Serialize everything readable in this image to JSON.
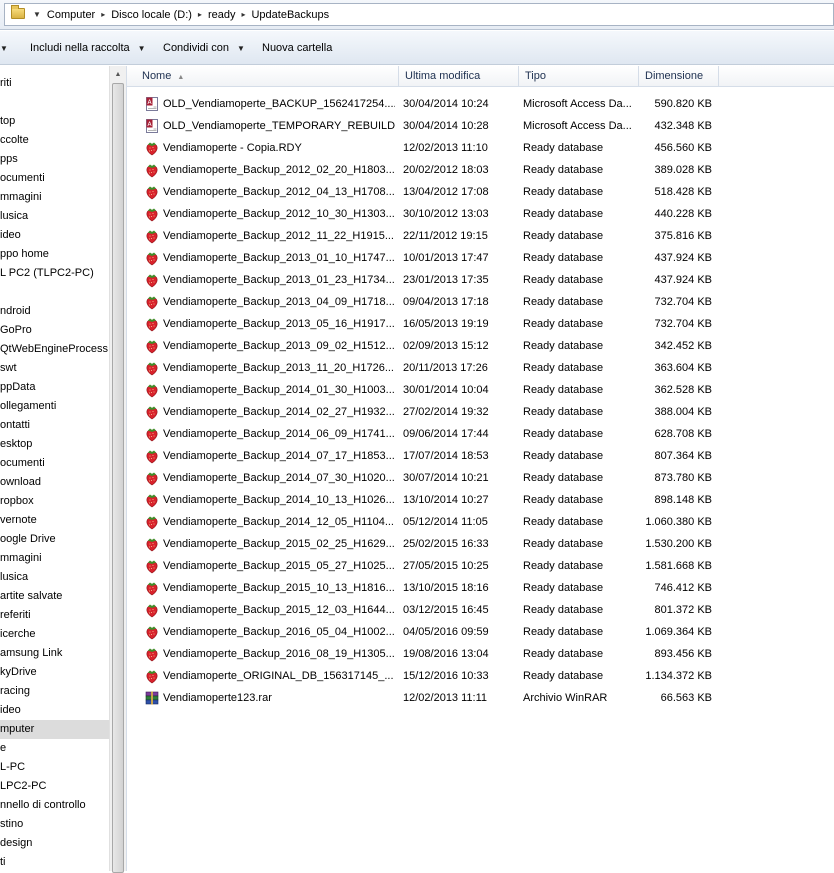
{
  "address": {
    "crumbs": [
      "Computer",
      "Disco locale (D:)",
      "ready",
      "UpdateBackups"
    ]
  },
  "toolbar": {
    "include_label": "Includi nella raccolta",
    "share_label": "Condividi con",
    "new_folder_label": "Nuova cartella"
  },
  "sidebar": {
    "items": [
      {
        "label": "riti"
      },
      {
        "label": "top"
      },
      {
        "label": "ccolte"
      },
      {
        "label": "pps"
      },
      {
        "label": "ocumenti"
      },
      {
        "label": "mmagini"
      },
      {
        "label": "lusica"
      },
      {
        "label": "ideo"
      },
      {
        "label": "ppo home"
      },
      {
        "label": "L PC2 (TLPC2-PC)"
      },
      {
        "label": "ndroid"
      },
      {
        "label": "GoPro"
      },
      {
        "label": "QtWebEngineProcess"
      },
      {
        "label": "swt"
      },
      {
        "label": "ppData"
      },
      {
        "label": "ollegamenti"
      },
      {
        "label": "ontatti"
      },
      {
        "label": "esktop"
      },
      {
        "label": "ocumenti"
      },
      {
        "label": "ownload"
      },
      {
        "label": "ropbox"
      },
      {
        "label": "vernote"
      },
      {
        "label": "oogle Drive"
      },
      {
        "label": "mmagini"
      },
      {
        "label": "lusica"
      },
      {
        "label": "artite salvate"
      },
      {
        "label": "referiti"
      },
      {
        "label": "icerche"
      },
      {
        "label": "amsung Link"
      },
      {
        "label": "kyDrive"
      },
      {
        "label": "racing"
      },
      {
        "label": "ideo"
      },
      {
        "label": "mputer"
      },
      {
        "label": "e"
      },
      {
        "label": "L-PC"
      },
      {
        "label": "LPC2-PC"
      },
      {
        "label": "nnello di controllo"
      },
      {
        "label": "stino"
      },
      {
        "label": "design"
      },
      {
        "label": "ti"
      }
    ]
  },
  "columns": {
    "name": "Nome",
    "modified": "Ultima modifica",
    "type": "Tipo",
    "size": "Dimensione"
  },
  "files": [
    {
      "icon": "access-icon",
      "name": "OLD_Vendiamoperte_BACKUP_1562417254....",
      "modified": "30/04/2014 10:24",
      "type": "Microsoft Access Da...",
      "size": "590.820 KB"
    },
    {
      "icon": "access-icon",
      "name": "OLD_Vendiamoperte_TEMPORARY_REBUILD...",
      "modified": "30/04/2014 10:28",
      "type": "Microsoft Access Da...",
      "size": "432.348 KB"
    },
    {
      "icon": "strawberry-icon",
      "name": "Vendiamoperte - Copia.RDY",
      "modified": "12/02/2013 11:10",
      "type": "Ready database",
      "size": "456.560 KB"
    },
    {
      "icon": "strawberry-icon",
      "name": "Vendiamoperte_Backup_2012_02_20_H1803...",
      "modified": "20/02/2012 18:03",
      "type": "Ready database",
      "size": "389.028 KB"
    },
    {
      "icon": "strawberry-icon",
      "name": "Vendiamoperte_Backup_2012_04_13_H1708...",
      "modified": "13/04/2012 17:08",
      "type": "Ready database",
      "size": "518.428 KB"
    },
    {
      "icon": "strawberry-icon",
      "name": "Vendiamoperte_Backup_2012_10_30_H1303...",
      "modified": "30/10/2012 13:03",
      "type": "Ready database",
      "size": "440.228 KB"
    },
    {
      "icon": "strawberry-icon",
      "name": "Vendiamoperte_Backup_2012_11_22_H1915...",
      "modified": "22/11/2012 19:15",
      "type": "Ready database",
      "size": "375.816 KB"
    },
    {
      "icon": "strawberry-icon",
      "name": "Vendiamoperte_Backup_2013_01_10_H1747...",
      "modified": "10/01/2013 17:47",
      "type": "Ready database",
      "size": "437.924 KB"
    },
    {
      "icon": "strawberry-icon",
      "name": "Vendiamoperte_Backup_2013_01_23_H1734...",
      "modified": "23/01/2013 17:35",
      "type": "Ready database",
      "size": "437.924 KB"
    },
    {
      "icon": "strawberry-icon",
      "name": "Vendiamoperte_Backup_2013_04_09_H1718...",
      "modified": "09/04/2013 17:18",
      "type": "Ready database",
      "size": "732.704 KB"
    },
    {
      "icon": "strawberry-icon",
      "name": "Vendiamoperte_Backup_2013_05_16_H1917...",
      "modified": "16/05/2013 19:19",
      "type": "Ready database",
      "size": "732.704 KB"
    },
    {
      "icon": "strawberry-icon",
      "name": "Vendiamoperte_Backup_2013_09_02_H1512...",
      "modified": "02/09/2013 15:12",
      "type": "Ready database",
      "size": "342.452 KB"
    },
    {
      "icon": "strawberry-icon",
      "name": "Vendiamoperte_Backup_2013_11_20_H1726...",
      "modified": "20/11/2013 17:26",
      "type": "Ready database",
      "size": "363.604 KB"
    },
    {
      "icon": "strawberry-icon",
      "name": "Vendiamoperte_Backup_2014_01_30_H1003...",
      "modified": "30/01/2014 10:04",
      "type": "Ready database",
      "size": "362.528 KB"
    },
    {
      "icon": "strawberry-icon",
      "name": "Vendiamoperte_Backup_2014_02_27_H1932...",
      "modified": "27/02/2014 19:32",
      "type": "Ready database",
      "size": "388.004 KB"
    },
    {
      "icon": "strawberry-icon",
      "name": "Vendiamoperte_Backup_2014_06_09_H1741...",
      "modified": "09/06/2014 17:44",
      "type": "Ready database",
      "size": "628.708 KB"
    },
    {
      "icon": "strawberry-icon",
      "name": "Vendiamoperte_Backup_2014_07_17_H1853...",
      "modified": "17/07/2014 18:53",
      "type": "Ready database",
      "size": "807.364 KB"
    },
    {
      "icon": "strawberry-icon",
      "name": "Vendiamoperte_Backup_2014_07_30_H1020...",
      "modified": "30/07/2014 10:21",
      "type": "Ready database",
      "size": "873.780 KB"
    },
    {
      "icon": "strawberry-icon",
      "name": "Vendiamoperte_Backup_2014_10_13_H1026...",
      "modified": "13/10/2014 10:27",
      "type": "Ready database",
      "size": "898.148 KB"
    },
    {
      "icon": "strawberry-icon",
      "name": "Vendiamoperte_Backup_2014_12_05_H1104...",
      "modified": "05/12/2014 11:05",
      "type": "Ready database",
      "size": "1.060.380 KB"
    },
    {
      "icon": "strawberry-icon",
      "name": "Vendiamoperte_Backup_2015_02_25_H1629...",
      "modified": "25/02/2015 16:33",
      "type": "Ready database",
      "size": "1.530.200 KB"
    },
    {
      "icon": "strawberry-icon",
      "name": "Vendiamoperte_Backup_2015_05_27_H1025...",
      "modified": "27/05/2015 10:25",
      "type": "Ready database",
      "size": "1.581.668 KB"
    },
    {
      "icon": "strawberry-icon",
      "name": "Vendiamoperte_Backup_2015_10_13_H1816...",
      "modified": "13/10/2015 18:16",
      "type": "Ready database",
      "size": "746.412 KB"
    },
    {
      "icon": "strawberry-icon",
      "name": "Vendiamoperte_Backup_2015_12_03_H1644...",
      "modified": "03/12/2015 16:45",
      "type": "Ready database",
      "size": "801.372 KB"
    },
    {
      "icon": "strawberry-icon",
      "name": "Vendiamoperte_Backup_2016_05_04_H1002...",
      "modified": "04/05/2016 09:59",
      "type": "Ready database",
      "size": "1.069.364 KB"
    },
    {
      "icon": "strawberry-icon",
      "name": "Vendiamoperte_Backup_2016_08_19_H1305...",
      "modified": "19/08/2016 13:04",
      "type": "Ready database",
      "size": "893.456 KB"
    },
    {
      "icon": "strawberry-icon",
      "name": "Vendiamoperte_ORIGINAL_DB_156317145_...",
      "modified": "15/12/2016 10:33",
      "type": "Ready database",
      "size": "1.134.372 KB"
    },
    {
      "icon": "winrar-icon",
      "name": "Vendiamoperte123.rar",
      "modified": "12/02/2013 11:11",
      "type": "Archivio WinRAR",
      "size": "66.563 KB"
    }
  ]
}
